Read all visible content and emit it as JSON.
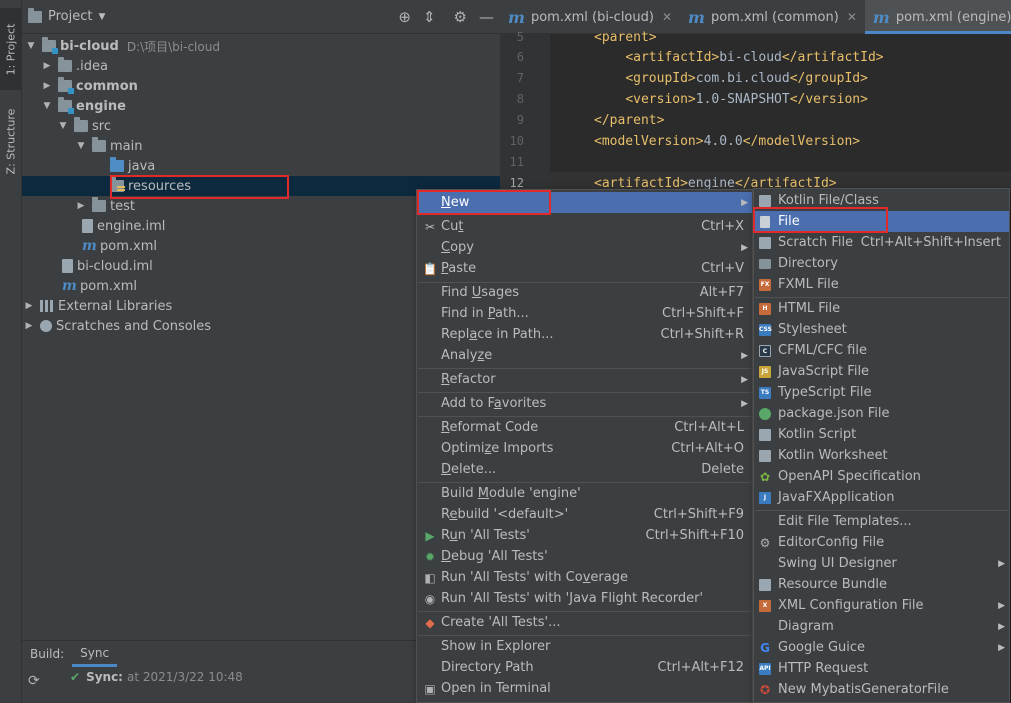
{
  "left_strip": {
    "project_tab": "1: Project",
    "structure_tab": "Z: Structure"
  },
  "project_panel": {
    "title": "Project",
    "tree": [
      {
        "label": "bi-cloud",
        "path": "D:\\项目\\bi-cloud"
      },
      {
        "label": ".idea"
      },
      {
        "label": "common"
      },
      {
        "label": "engine"
      },
      {
        "label": "src"
      },
      {
        "label": "main"
      },
      {
        "label": "java"
      },
      {
        "label": "resources"
      },
      {
        "label": "test"
      },
      {
        "label": "engine.iml"
      },
      {
        "label": "pom.xml"
      },
      {
        "label": "bi-cloud.iml"
      },
      {
        "label": "pom.xml"
      },
      {
        "label": "External Libraries"
      },
      {
        "label": "Scratches and Consoles"
      }
    ]
  },
  "editor": {
    "tabs": [
      {
        "label": "pom.xml (bi-cloud)"
      },
      {
        "label": "pom.xml (common)"
      },
      {
        "label": "pom.xml (engine)"
      }
    ],
    "lines": [
      {
        "num": "5",
        "indent": "",
        "open": "<parent>",
        "text": "",
        "close": ""
      },
      {
        "num": "6",
        "indent": "    ",
        "open": "<artifactId>",
        "text": "bi-cloud",
        "close": "</artifactId>"
      },
      {
        "num": "7",
        "indent": "    ",
        "open": "<groupId>",
        "text": "com.bi.cloud",
        "close": "</groupId>"
      },
      {
        "num": "8",
        "indent": "    ",
        "open": "<version>",
        "text": "1.0-SNAPSHOT",
        "close": "</version>"
      },
      {
        "num": "9",
        "indent": "",
        "open": "</parent>",
        "text": "",
        "close": ""
      },
      {
        "num": "10",
        "indent": "",
        "open": "<modelVersion>",
        "text": "4.0.0",
        "close": "</modelVersion>"
      },
      {
        "num": "11",
        "indent": "",
        "open": "",
        "text": "",
        "close": ""
      },
      {
        "num": "12",
        "indent": "",
        "open": "<artifactId>",
        "text": "engine",
        "close": "</artifactId>"
      }
    ]
  },
  "build_panel": {
    "tabs": [
      "Build:",
      "Sync"
    ],
    "status_label": "Sync:",
    "status_time": "at 2021/3/22 10:48"
  },
  "context_menu": {
    "items": [
      {
        "pre": "",
        "u": "N",
        "post": "ew",
        "shortcut": "",
        "submenu": true
      },
      {
        "pre": "Cu",
        "u": "t",
        "post": "",
        "shortcut": "Ctrl+X",
        "submenu": false
      },
      {
        "pre": "",
        "u": "C",
        "post": "opy",
        "shortcut": "",
        "submenu": true
      },
      {
        "pre": "",
        "u": "P",
        "post": "aste",
        "shortcut": "Ctrl+V",
        "submenu": false
      },
      {
        "pre": "Find ",
        "u": "U",
        "post": "sages",
        "shortcut": "Alt+F7",
        "submenu": false
      },
      {
        "pre": "Find in ",
        "u": "P",
        "post": "ath...",
        "shortcut": "Ctrl+Shift+F",
        "submenu": false
      },
      {
        "pre": "Repl",
        "u": "a",
        "post": "ce in Path...",
        "shortcut": "Ctrl+Shift+R",
        "submenu": false
      },
      {
        "pre": "Analy",
        "u": "z",
        "post": "e",
        "shortcut": "",
        "submenu": true
      },
      {
        "pre": "",
        "u": "R",
        "post": "efactor",
        "shortcut": "",
        "submenu": true
      },
      {
        "pre": "Add to F",
        "u": "a",
        "post": "vorites",
        "shortcut": "",
        "submenu": true
      },
      {
        "pre": "",
        "u": "R",
        "post": "eformat Code",
        "shortcut": "Ctrl+Alt+L",
        "submenu": false
      },
      {
        "pre": "Optimi",
        "u": "z",
        "post": "e Imports",
        "shortcut": "Ctrl+Alt+O",
        "submenu": false
      },
      {
        "pre": "",
        "u": "D",
        "post": "elete...",
        "shortcut": "Delete",
        "submenu": false
      },
      {
        "pre": "Build ",
        "u": "M",
        "post": "odule 'engine'",
        "shortcut": "",
        "submenu": false
      },
      {
        "pre": "R",
        "u": "e",
        "post": "build '<default>'",
        "shortcut": "Ctrl+Shift+F9",
        "submenu": false
      },
      {
        "pre": "R",
        "u": "u",
        "post": "n 'All Tests'",
        "shortcut": "Ctrl+Shift+F10",
        "submenu": false
      },
      {
        "pre": "",
        "u": "D",
        "post": "ebug 'All Tests'",
        "shortcut": "",
        "submenu": false
      },
      {
        "pre": "Run 'All Tests' with Co",
        "u": "v",
        "post": "erage",
        "shortcut": "",
        "submenu": false
      },
      {
        "pre": "Run 'All Tests' with 'Java Flight Recorder'",
        "u": "",
        "post": "",
        "shortcut": "",
        "submenu": false
      },
      {
        "pre": "Create 'All Tests'...",
        "u": "",
        "post": "",
        "shortcut": "",
        "submenu": false
      },
      {
        "pre": "Show in Explorer",
        "u": "",
        "post": "",
        "shortcut": "",
        "submenu": false
      },
      {
        "pre": "Director",
        "u": "y",
        "post": " Path",
        "shortcut": "Ctrl+Alt+F12",
        "submenu": false
      },
      {
        "pre": "Open in Terminal",
        "u": "",
        "post": "",
        "shortcut": "",
        "submenu": false
      }
    ]
  },
  "new_submenu": {
    "items": [
      {
        "label": "Kotlin File/Class",
        "shortcut": "",
        "submenu": false
      },
      {
        "label": "File",
        "shortcut": "",
        "submenu": false
      },
      {
        "label": "Scratch File",
        "shortcut": "Ctrl+Alt+Shift+Insert",
        "submenu": false
      },
      {
        "label": "Directory",
        "shortcut": "",
        "submenu": false
      },
      {
        "label": "FXML File",
        "shortcut": "",
        "submenu": false
      },
      {
        "label": "HTML File",
        "shortcut": "",
        "submenu": false
      },
      {
        "label": "Stylesheet",
        "shortcut": "",
        "submenu": false
      },
      {
        "label": "CFML/CFC file",
        "shortcut": "",
        "submenu": false
      },
      {
        "label": "JavaScript File",
        "shortcut": "",
        "submenu": false
      },
      {
        "label": "TypeScript File",
        "shortcut": "",
        "submenu": false
      },
      {
        "label": "package.json File",
        "shortcut": "",
        "submenu": false
      },
      {
        "label": "Kotlin Script",
        "shortcut": "",
        "submenu": false
      },
      {
        "label": "Kotlin Worksheet",
        "shortcut": "",
        "submenu": false
      },
      {
        "label": "OpenAPI Specification",
        "shortcut": "",
        "submenu": false
      },
      {
        "label": "JavaFXApplication",
        "shortcut": "",
        "submenu": false
      },
      {
        "label": "Edit File Templates...",
        "shortcut": "",
        "submenu": false
      },
      {
        "label": "EditorConfig File",
        "shortcut": "",
        "submenu": false
      },
      {
        "label": "Swing UI Designer",
        "shortcut": "",
        "submenu": true
      },
      {
        "label": "Resource Bundle",
        "shortcut": "",
        "submenu": false
      },
      {
        "label": "XML Configuration File",
        "shortcut": "",
        "submenu": true
      },
      {
        "label": "Diagram",
        "shortcut": "",
        "submenu": true
      },
      {
        "label": "Google Guice",
        "shortcut": "",
        "submenu": true
      },
      {
        "label": "HTTP Request",
        "shortcut": "",
        "submenu": false
      },
      {
        "label": "New MybatisGeneratorFile",
        "shortcut": "",
        "submenu": false
      }
    ]
  },
  "colors": {
    "highlight": "#4b6eaf",
    "annotation_box": "#e22a2a",
    "tag": "#e8bf6a"
  }
}
